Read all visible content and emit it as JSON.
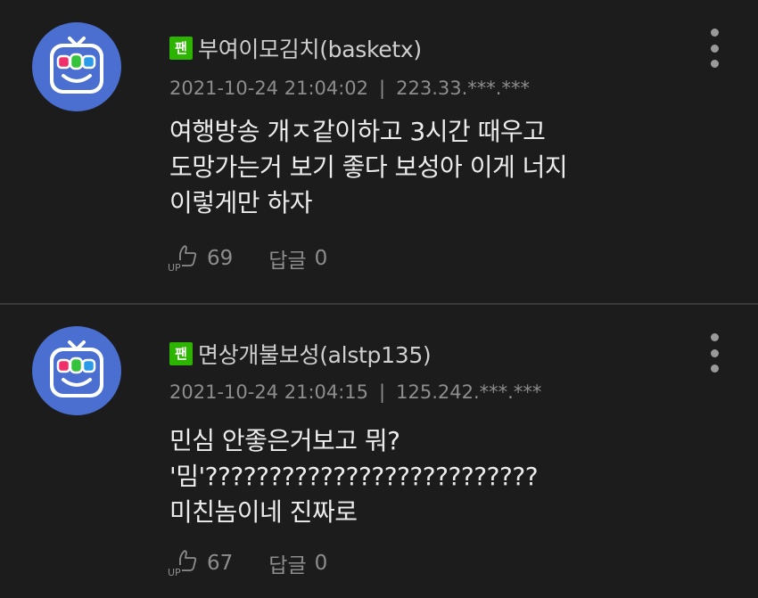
{
  "comments": [
    {
      "fan_badge": "팬",
      "author": "부여이모김치(basketx)",
      "date": "2021-10-24 21:04:02",
      "separator": "|",
      "ip": "223.33.***.***",
      "lines": [
        "여행방송 개ㅈ같이하고 3시간 때우고",
        "도망가는거 보기 좋다 보성아 이게 너지",
        "이렇게만 하자"
      ],
      "likes": "69",
      "reply_label": "답글",
      "reply_count": "0",
      "avatar_icon": "tv-mascot-icon",
      "more_icon": "more-vertical-icon",
      "like_icon": "thumbs-up-icon"
    },
    {
      "fan_badge": "팬",
      "author": "면상개불보성(alstp135)",
      "date": "2021-10-24 21:04:15",
      "separator": "|",
      "ip": "125.242.***.***",
      "lines": [
        "민심 안좋은거보고 뭐?",
        "'밈'??????????????????????????",
        "미친놈이네 진짜로"
      ],
      "likes": "67",
      "reply_label": "답글",
      "reply_count": "0",
      "avatar_icon": "tv-mascot-icon",
      "more_icon": "more-vertical-icon",
      "like_icon": "thumbs-up-icon"
    }
  ],
  "colors": {
    "background": "#1c1c1c",
    "divider": "#3a3a3a",
    "avatar_bg": "#4a6fd1",
    "fan_badge": "#2db400",
    "author_text": "#cfcfcf",
    "meta_text": "#8d8d8d",
    "body_text": "#ececec"
  }
}
